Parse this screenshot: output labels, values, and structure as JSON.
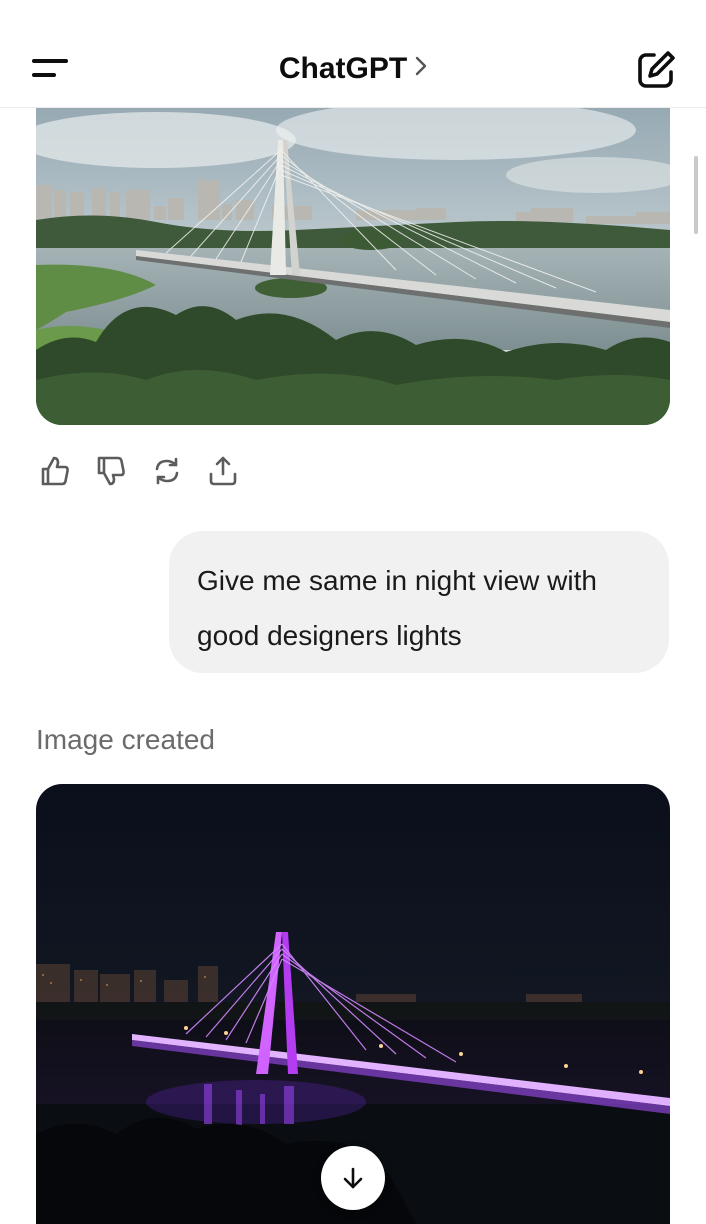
{
  "header": {
    "title": "ChatGPT",
    "menu_icon": "menu-icon",
    "title_chevron_icon": "chevron-right-icon",
    "new_chat_icon": "new-chat-edit-icon"
  },
  "messages": {
    "previous_image": {
      "description_icon": "generated-image"
    },
    "actions": [
      {
        "icon": "thumbs-up-icon"
      },
      {
        "icon": "thumbs-down-icon"
      },
      {
        "icon": "regenerate-icon"
      },
      {
        "icon": "share-icon"
      }
    ],
    "user_message": "Give me same in night view with good designers lights",
    "assistant_status": "Image created"
  },
  "scroll_down_icon": "arrow-down-icon",
  "colors": {
    "bubble_bg": "#f1f1f1",
    "status_text": "#6b6b6b",
    "bridge_night_light": "#c83cff"
  }
}
